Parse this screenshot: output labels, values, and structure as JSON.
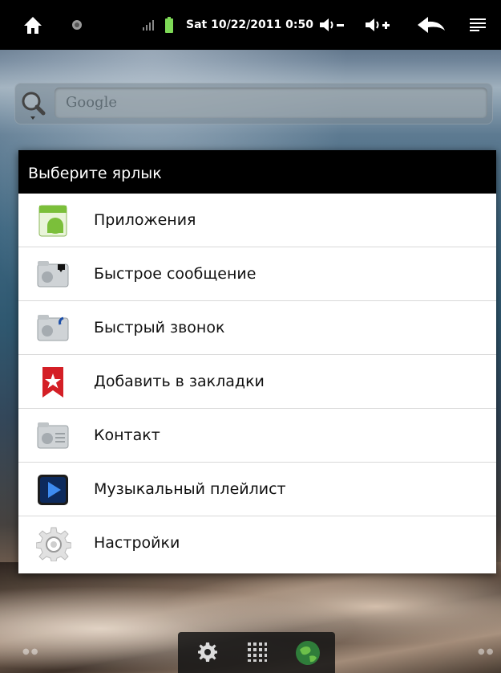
{
  "status_bar": {
    "datetime": "Sat 10/22/2011 0:50",
    "icons": [
      "home-icon",
      "record-icon",
      "signal-icon",
      "battery-icon",
      "volume-down-icon",
      "volume-up-icon",
      "back-icon",
      "menu-icon"
    ]
  },
  "search": {
    "placeholder": "Google"
  },
  "dialog": {
    "title": "Выберите ярлык",
    "items": [
      {
        "label": "Приложения",
        "icon": "android-apps-icon"
      },
      {
        "label": "Быстрое сообщение",
        "icon": "direct-message-icon"
      },
      {
        "label": "Быстрый звонок",
        "icon": "direct-dial-icon"
      },
      {
        "label": "Добавить в закладки",
        "icon": "bookmark-icon"
      },
      {
        "label": "Контакт",
        "icon": "contact-icon"
      },
      {
        "label": "Музыкальный плейлист",
        "icon": "music-playlist-icon"
      },
      {
        "label": "Настройки",
        "icon": "settings-gear-icon"
      }
    ]
  },
  "dock": {
    "icons": [
      "settings-gear-icon",
      "app-grid-icon",
      "browser-globe-icon"
    ]
  },
  "colors": {
    "status_bar_bg": "#000000",
    "dialog_title_bg": "#000000",
    "dialog_bg": "#ffffff",
    "bookmark_red": "#d41f26"
  }
}
